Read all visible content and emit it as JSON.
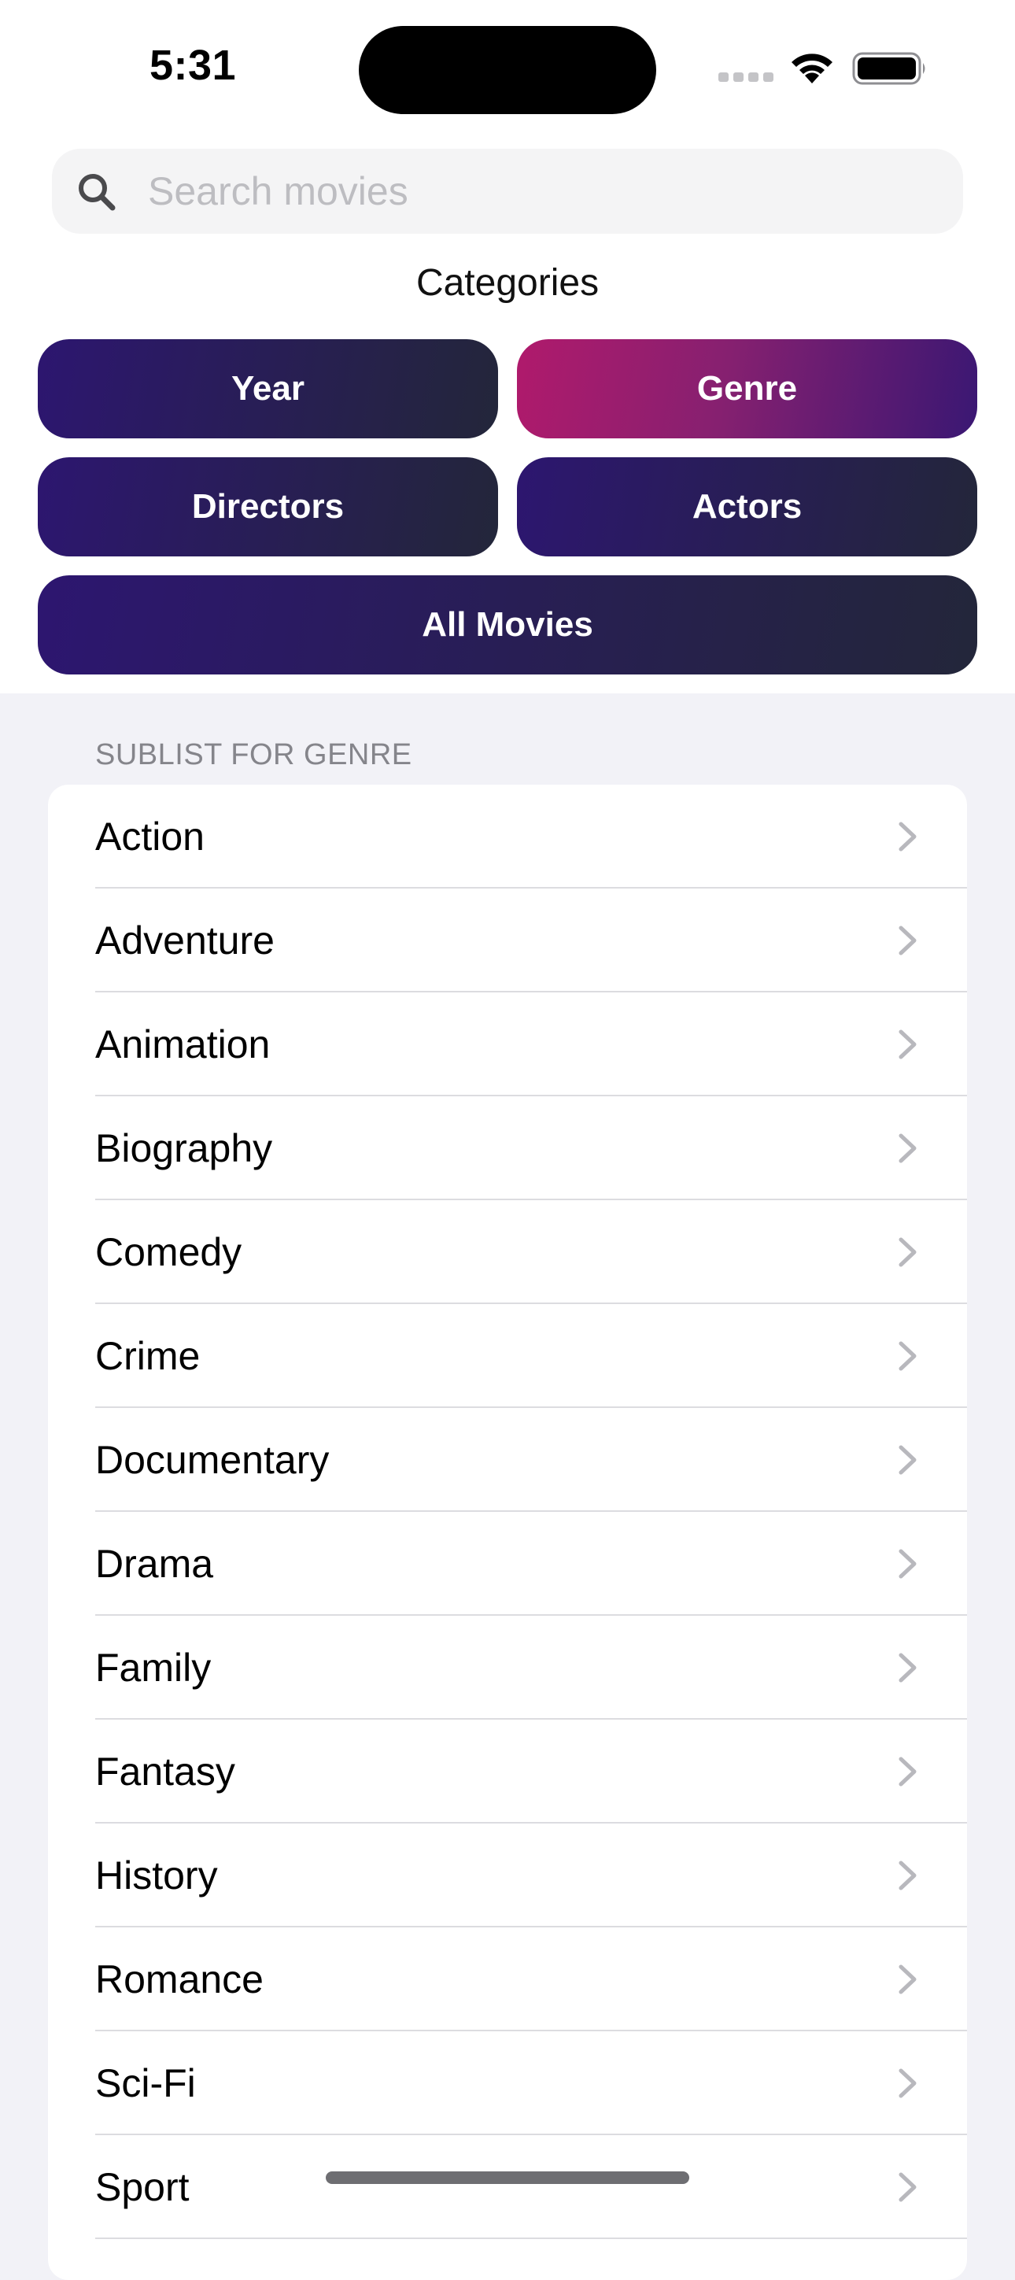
{
  "status_bar": {
    "time": "5:31"
  },
  "search": {
    "placeholder": "Search movies",
    "value": ""
  },
  "categories": {
    "title": "Categories",
    "buttons": [
      {
        "label": "Year",
        "active": false
      },
      {
        "label": "Genre",
        "active": true
      },
      {
        "label": "Directors",
        "active": false
      },
      {
        "label": "Actors",
        "active": false
      },
      {
        "label": "All Movies",
        "active": false
      }
    ]
  },
  "sublist": {
    "header": "SUBLIST FOR GENRE",
    "items": [
      {
        "label": "Action"
      },
      {
        "label": "Adventure"
      },
      {
        "label": "Animation"
      },
      {
        "label": "Biography"
      },
      {
        "label": "Comedy"
      },
      {
        "label": "Crime"
      },
      {
        "label": "Documentary"
      },
      {
        "label": "Drama"
      },
      {
        "label": "Family"
      },
      {
        "label": "Fantasy"
      },
      {
        "label": "History"
      },
      {
        "label": "Romance"
      },
      {
        "label": "Sci-Fi"
      },
      {
        "label": "Sport"
      }
    ]
  },
  "colors": {
    "button_gradient": [
      "#2d1670",
      "#23263a"
    ],
    "active_gradient": [
      "#b01a6c",
      "#3a1773"
    ],
    "grouped_background": "#f2f2f7"
  }
}
